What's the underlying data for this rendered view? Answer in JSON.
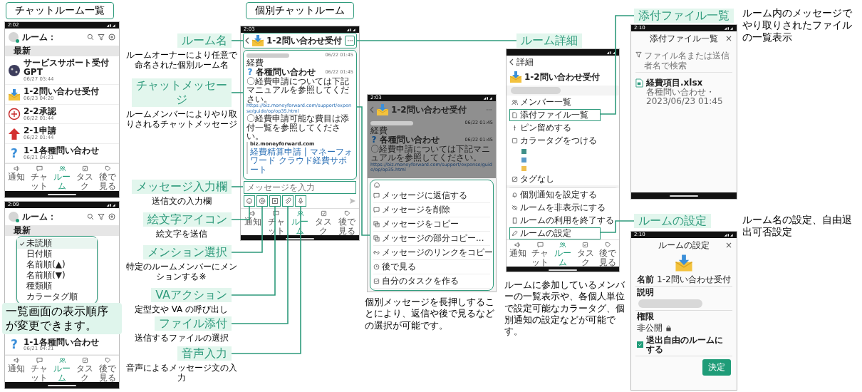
{
  "list_view": {
    "title": "チャットルーム一覧",
    "phone": {
      "status_time": "2:02",
      "header": "ルーム：",
      "section": "最新",
      "rooms": [
        {
          "name": "サービスサポート受付 GPT",
          "time": "06/27 03:44"
        },
        {
          "name": "1-2問い合わせ受付",
          "time": "06/23 04:20"
        },
        {
          "name": "2-2承認",
          "time": "06/22 01:44"
        },
        {
          "name": "2-1申請",
          "time": "06/22 01:44"
        },
        {
          "name": "1-1各種問い合わせ",
          "time": "06/21 04:21",
          "avatar_glyph": "?"
        }
      ],
      "tabs": [
        {
          "label": "通知",
          "selected": false
        },
        {
          "label": "チャット",
          "selected": false
        },
        {
          "label": "ルーム",
          "selected": true
        },
        {
          "label": "タスク",
          "selected": false
        },
        {
          "label": "後で見る",
          "selected": false
        }
      ]
    },
    "sort_phone": {
      "status_time": "2:09",
      "header": "ルーム：",
      "section": "最新",
      "sort_options": [
        {
          "label": "未読順",
          "selected": true
        },
        {
          "label": "日付順",
          "selected": false
        },
        {
          "label": "名前順(▲)",
          "selected": false
        },
        {
          "label": "名前順(▼)",
          "selected": false
        },
        {
          "label": "種類順",
          "selected": false
        },
        {
          "label": "カラータグ順",
          "selected": false
        }
      ],
      "rooms": [
        {
          "name": "1-1各種問い合わせ",
          "time": "06/21 04:21",
          "avatar_glyph": "?"
        }
      ],
      "tabs": [
        {
          "label": "通知",
          "selected": false
        },
        {
          "label": "チャット",
          "selected": false
        },
        {
          "label": "ルーム",
          "selected": true
        },
        {
          "label": "タスク",
          "selected": false
        },
        {
          "label": "後で見る",
          "selected": false
        }
      ]
    },
    "callout": "一覧画面の表示順序が変更できます。"
  },
  "chat_room": {
    "title": "個別チャットルーム",
    "phone": {
      "status_time": "2:03",
      "room_name": "1-2問い合わせ受付",
      "messages": [
        {
          "time": "06/22 01:45",
          "text": "経費"
        },
        {
          "sender": "各種問い合わせ",
          "avatar_glyph": "?",
          "time": "06/22 01:45",
          "text": "〇経費申請については下記マニュアルを参照してください。",
          "link": "https://biz.moneyforward.com/support/expense/guide/op/op35.html",
          "text_2": "〇経費申請可能な費目は添付一覧を参照してください。",
          "preview_site": "biz.moneyforward.com",
          "preview_title": "経費精算申請 | マネーフォワード クラウド経費サポート"
        }
      ],
      "input": {
        "placeholder": "メッセージを入力"
      },
      "tabs": [
        {
          "label": "通知",
          "selected": false
        },
        {
          "label": "チャット",
          "selected": false
        },
        {
          "label": "ルーム",
          "selected": true
        },
        {
          "label": "タスク",
          "selected": false
        },
        {
          "label": "後で見る",
          "selected": false
        }
      ]
    }
  },
  "annotations": [
    {
      "label": "ルーム名",
      "description": "ルームオーナーにより任意で命名された個別ルーム名"
    },
    {
      "label": "チャットメッセージ",
      "description": "ルームメンバーによりやり取りされるチャットメッセージ"
    },
    {
      "label": "メッセージ入力欄",
      "description": "送信文の入力欄"
    },
    {
      "label": "絵文字アイコン",
      "description": "絵文字を送信"
    },
    {
      "label": "メンション選択",
      "description": "特定のルームメンバーにメンションする※"
    },
    {
      "label": "VAアクション",
      "description": "定型文や VA の呼び出し"
    },
    {
      "label": "ファイル添付",
      "description": "送信するファイルの選択"
    },
    {
      "label": "音声入力",
      "description": "音声によるメッセージ文の入力"
    }
  ],
  "message_menu": {
    "phone": {
      "status_time": "2:03",
      "room_name": "1-2問い合わせ受付",
      "messages": [
        {
          "time": "06/22 01:45",
          "text": "経費"
        },
        {
          "sender": "各種問い合わせ",
          "avatar_glyph": "?",
          "time": "06/22 01:45",
          "text": "〇経費申請については下記マニュアルを参照してください。",
          "link": "https://biz.moneyforward.com/support/expense/guide/op/op35.html"
        }
      ],
      "menu": [
        "メッセージに返信する",
        "メッセージを削除",
        "メッセージをコピー",
        "メッセージの部分コピー...",
        "メッセージのリンクをコピー",
        "後で見る",
        "自分のタスクを作る"
      ]
    },
    "caption": "個別メッセージを長押しすることにより、返信や後で見るなどの選択が可能です。"
  },
  "room_detail": {
    "label": "ルーム詳細",
    "phone": {
      "header": "詳細",
      "room_name": "1-2問い合わせ受付",
      "items": [
        {
          "kind": "action",
          "label": "メンバー一覧",
          "highlighted": false
        },
        {
          "kind": "action",
          "label": "添付ファイル一覧",
          "highlighted": true
        },
        {
          "kind": "action",
          "label": "ピン留めする",
          "highlighted": false
        },
        {
          "kind": "action",
          "label": "カラータグをつける",
          "highlighted": false
        },
        {
          "kind": "color",
          "color": "#3f8f88",
          "highlighted": false
        },
        {
          "kind": "color",
          "color": "#5b9ac8",
          "highlighted": false
        },
        {
          "kind": "color",
          "color": "#f0c050",
          "highlighted": false
        },
        {
          "kind": "action",
          "label": "タグなし",
          "highlighted": false
        }
      ],
      "sheet_items": [
        {
          "label": "個別通知を設定する",
          "highlighted": false
        },
        {
          "label": "ルームを非表示にする",
          "highlighted": false
        },
        {
          "label": "ルームの利用を終了する",
          "highlighted": false
        },
        {
          "label": "ルームの設定",
          "highlighted": true
        }
      ],
      "tabs": [
        {
          "label": "通知",
          "selected": false
        },
        {
          "label": "チャット",
          "selected": false
        },
        {
          "label": "ルーム",
          "selected": true
        },
        {
          "label": "タスク",
          "selected": false
        },
        {
          "label": "後で見る",
          "selected": false
        }
      ]
    },
    "caption": "ルームに参加しているメンバーの一覧表示や、各個人単位で設定可能なカラータグ、個別通知の設定などが可能です。"
  },
  "attachments": {
    "label": "添付ファイル一覧",
    "description": "ルーム内のメッセージでやり取りされたファイルの一覧表示",
    "phone": {
      "status_time": "2:10",
      "title": "添付ファイル一覧",
      "close": "×",
      "search_placeholder": "ファイル名または送信者名で検索",
      "files": [
        {
          "name": "経費項目.xlsx",
          "meta": "各種問い合わせ・2023/06/23 01:45"
        }
      ]
    }
  },
  "room_settings": {
    "label": "ルームの設定",
    "description": "ルーム名の設定、自由退出可否設定",
    "phone": {
      "status_time": "2:10",
      "title": "ルームの設定",
      "close": "×",
      "name_label": "名前",
      "name_value": "1-2問い合わせ受付",
      "description_label": "説明",
      "permission_label": "権限",
      "permission_value": "非公開",
      "leave_option": {
        "label": "退出自由のルームにする",
        "checked": true
      },
      "submit": "決定"
    }
  }
}
